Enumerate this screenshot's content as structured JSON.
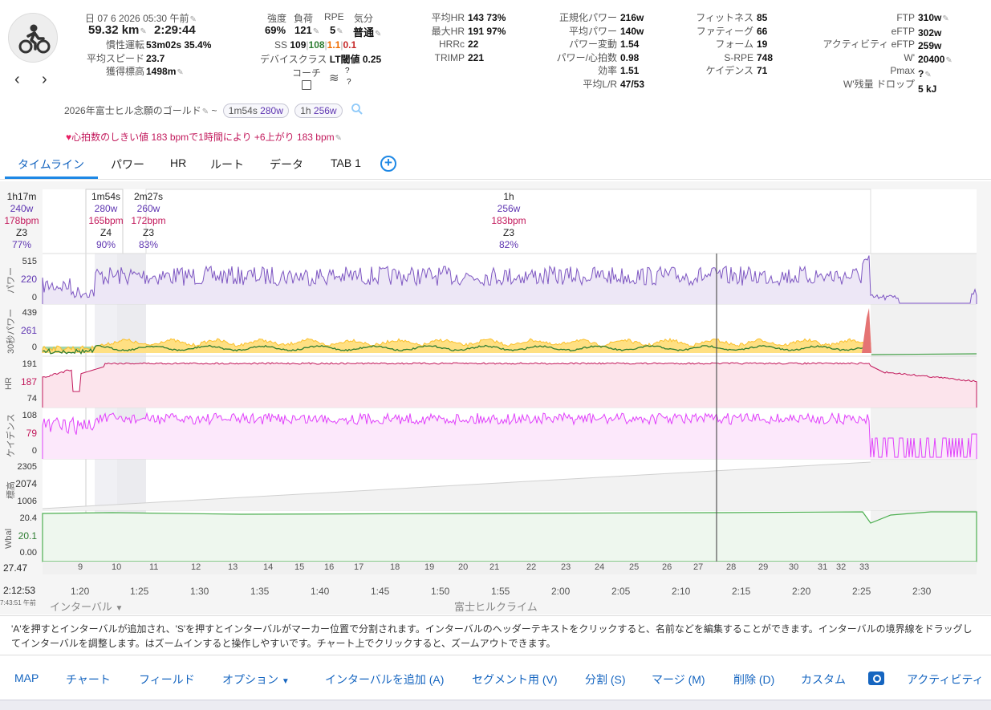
{
  "header": {
    "date": "日 07 6 2026",
    "time": "05:30 午前",
    "distance": "59.32 km",
    "duration": "2:29:44",
    "coasting_label": "慣性運転",
    "coasting_value": "53m02s 35.4%",
    "avg_speed_label": "平均スピード",
    "avg_speed_value": "23.7",
    "elev_label": "獲得標高",
    "elev_value": "1498m"
  },
  "load": {
    "intensity_label": "強度",
    "intensity_value": "69%",
    "load_label": "負荷",
    "load_value": "121",
    "rpe_label": "RPE",
    "rpe_value": "5",
    "mood_label": "気分",
    "mood_value": "普通",
    "ss_label": "SS",
    "ss_value": "109",
    "ss_g": "108",
    "ss_o": "1.1",
    "ss_r": "0.1",
    "devclass_label": "デバイスクラス",
    "devclass_value": "LT閾値 0.25",
    "coach_label": "コーチ",
    "q1": "?",
    "q2": "?"
  },
  "hr": {
    "avg_label": "平均HR",
    "avg_value": "143 73%",
    "max_label": "最大HR",
    "max_value": "191 97%",
    "hrrc_label": "HRRc",
    "hrrc_value": "22",
    "trimp_label": "TRIMP",
    "trimp_value": "221"
  },
  "power": {
    "np_label": "正規化パワー",
    "np_value": "216w",
    "avgp_label": "平均パワー",
    "avgp_value": "140w",
    "var_label": "パワー変動",
    "var_value": "1.54",
    "phr_label": "パワー/心拍数",
    "phr_value": "0.98",
    "eff_label": "効率",
    "eff_value": "1.51",
    "lr_label": "平均L/R",
    "lr_value": "47/53"
  },
  "fitness": {
    "fit_label": "フィットネス",
    "fit_value": "85",
    "fat_label": "ファティーグ",
    "fat_value": "66",
    "form_label": "フォーム",
    "form_value": "19",
    "srpe_label": "S-RPE",
    "srpe_value": "748",
    "cad_label": "ケイデンス",
    "cad_value": "71"
  },
  "ftp": {
    "ftp_label": "FTP",
    "ftp_value": "310w",
    "eftp_label": "eFTP",
    "eftp_value": "302w",
    "aeftp_label": "アクティビティ eFTP",
    "aeftp_value": "259w",
    "w_label": "W'",
    "w_value": "20400",
    "pmax_label": "Pmax",
    "pmax_value": "?",
    "wdrop_label": "W'残量 ドロップ",
    "wdrop_value": "5 kJ"
  },
  "segment": {
    "title": "2026年富士ヒル念願のゴールド",
    "tilde": "~",
    "chip1_time": "1m54s",
    "chip1_power": "280w",
    "chip2_time": "1h",
    "chip2_power": "256w"
  },
  "hr_note": "心拍数のしきい値 183 bpmで1時間により +6上がり 183 bpm",
  "tabs": [
    "タイムライン",
    "パワー",
    "HR",
    "ルート",
    "データ",
    "TAB 1"
  ],
  "intervals": [
    {
      "time": "1h17m",
      "w": "240w",
      "bpm": "178bpm",
      "zone": "Z3",
      "pct": "77%"
    },
    {
      "time": "1m54s",
      "w": "280w",
      "bpm": "165bpm",
      "zone": "Z4",
      "pct": "90%"
    },
    {
      "time": "2m27s",
      "w": "260w",
      "bpm": "172bpm",
      "zone": "Z3",
      "pct": "83%"
    },
    {
      "time": "1h",
      "w": "256w",
      "bpm": "183bpm",
      "zone": "Z3",
      "pct": "82%"
    }
  ],
  "panels": {
    "power_title": "パワー",
    "power_ticks": [
      "515",
      "220",
      "0"
    ],
    "p30_title": "30秒パワー",
    "p30_ticks": [
      "439",
      "261",
      "0"
    ],
    "hr_title": "HR",
    "hr_ticks": [
      "191",
      "187",
      "74"
    ],
    "cad_title": "ケイデンス",
    "cad_ticks": [
      "108",
      "79",
      "0"
    ],
    "alt_title": "標高",
    "alt_ticks": [
      "2305",
      "2074",
      "1006"
    ],
    "wbal_title": "Wbal",
    "wbal_ticks": [
      "20.4",
      "20.1",
      "0.00"
    ]
  },
  "interval_numbers": [
    "9",
    "10",
    "11",
    "12",
    "13",
    "14",
    "15",
    "16",
    "17",
    "18",
    "19",
    "20",
    "21",
    "22",
    "23",
    "24",
    "25",
    "26",
    "27",
    "28",
    "29",
    "30",
    "31",
    "32",
    "33"
  ],
  "xaxis": {
    "left_top": "27.47",
    "left_mid": "2:12:53",
    "left_small": "7:43:51 午前",
    "ticks": [
      "1:20",
      "1:25",
      "1:30",
      "1:35",
      "1:40",
      "1:45",
      "1:50",
      "1:55",
      "2:00",
      "2:05",
      "2:10",
      "2:15",
      "2:20",
      "2:25",
      "2:30"
    ],
    "interval_dropdown": "インターバル",
    "climb_label": "富士ヒルクライム"
  },
  "hint": "'A'を押すとインターバルが追加され、'S'を押すとインターバルがマーカー位置で分割されます。インターバルのヘッダーテキストをクリックすると、名前などを編集することができます。インターバルの境界線をドラッグしてインターバルを調整します。はズームインすると操作しやすいです。チャート上でクリックすると、ズームアウトできます。",
  "bottom": {
    "map": "MAP",
    "chart": "チャート",
    "fields": "フィールド",
    "options": "オプション",
    "add_interval": "インターバルを追加 (A)",
    "segment": "セグメント用 (V)",
    "split": "分割 (S)",
    "merge": "マージ (M)",
    "delete": "削除 (D)",
    "custom": "カスタム",
    "activity": "アクティビティ"
  },
  "colors": {
    "accent": "#1e88e5",
    "power": "#7e57c2",
    "hr": "#c2185b",
    "cadence": "#e040fb",
    "wbal": "#43a047"
  }
}
